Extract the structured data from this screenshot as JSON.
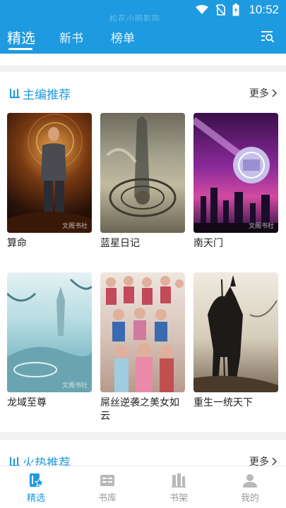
{
  "status_bar": {
    "time": "10:52",
    "ghost_text": "松花小明影院"
  },
  "top_nav": {
    "tabs": [
      {
        "label": "精选",
        "active": true
      },
      {
        "label": "新书",
        "active": false
      },
      {
        "label": "榜单",
        "active": false
      }
    ],
    "search_icon": "search-list-icon"
  },
  "sections": [
    {
      "title": "主编推荐",
      "more_label": "更多",
      "books": [
        {
          "title": "算命",
          "watermark": "文阁书社"
        },
        {
          "title": "蓝星日记",
          "watermark": ""
        },
        {
          "title": "南天门",
          "watermark": "文阁书社"
        },
        {
          "title": "龙域至尊",
          "watermark": "文阁书社"
        },
        {
          "title": "屌丝逆袭之美女如云",
          "watermark": ""
        },
        {
          "title": "重生一统天下",
          "watermark": ""
        }
      ]
    },
    {
      "title": "火热推荐",
      "more_label": "更多"
    }
  ],
  "bottom_nav": [
    {
      "label": "精选",
      "icon": "featured-icon",
      "active": true
    },
    {
      "label": "书库",
      "icon": "library-icon",
      "active": false
    },
    {
      "label": "书架",
      "icon": "bookshelf-icon",
      "active": false
    },
    {
      "label": "我的",
      "icon": "profile-icon",
      "active": false
    }
  ],
  "colors": {
    "brand": "#1e9ae0",
    "active_label": "#1e9ae0",
    "inactive": "#999999"
  }
}
